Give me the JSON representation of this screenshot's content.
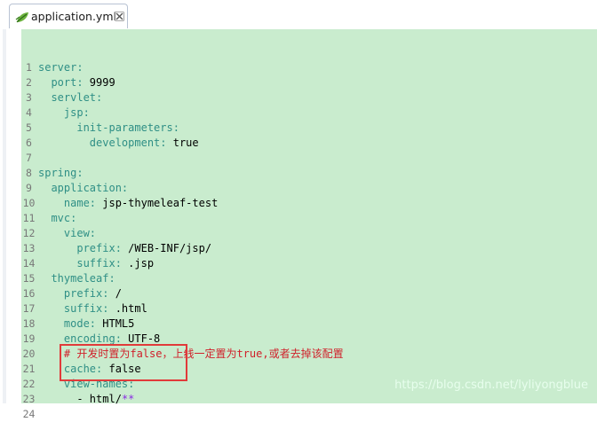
{
  "tab": {
    "title": "application.yml",
    "icon": "yaml-leaf-icon",
    "close_icon": "close-icon"
  },
  "editor": {
    "lines": [
      {
        "no": "1",
        "indent": "",
        "key": "server:",
        "value": "",
        "comment": ""
      },
      {
        "no": "2",
        "indent": "  ",
        "key": "port:",
        "value": " 9999",
        "comment": ""
      },
      {
        "no": "3",
        "indent": "  ",
        "key": "servlet:",
        "value": "",
        "comment": ""
      },
      {
        "no": "4",
        "indent": "    ",
        "key": "jsp:",
        "value": "",
        "comment": ""
      },
      {
        "no": "5",
        "indent": "      ",
        "key": "init-parameters:",
        "value": "",
        "comment": ""
      },
      {
        "no": "6",
        "indent": "        ",
        "key": "development:",
        "value": " true",
        "comment": ""
      },
      {
        "no": "7",
        "indent": "",
        "key": "",
        "value": "",
        "comment": ""
      },
      {
        "no": "8",
        "indent": "",
        "key": "spring:",
        "value": "",
        "comment": ""
      },
      {
        "no": "9",
        "indent": "  ",
        "key": "application:",
        "value": "",
        "comment": ""
      },
      {
        "no": "10",
        "indent": "    ",
        "key": "name:",
        "value": " jsp-thymeleaf-test",
        "comment": ""
      },
      {
        "no": "11",
        "indent": "  ",
        "key": "mvc:",
        "value": "",
        "comment": ""
      },
      {
        "no": "12",
        "indent": "    ",
        "key": "view:",
        "value": "",
        "comment": ""
      },
      {
        "no": "13",
        "indent": "      ",
        "key": "prefix:",
        "value": " /WEB-INF/jsp/",
        "comment": ""
      },
      {
        "no": "14",
        "indent": "      ",
        "key": "suffix:",
        "value": " .jsp",
        "comment": ""
      },
      {
        "no": "15",
        "indent": "  ",
        "key": "thymeleaf:",
        "value": "",
        "comment": ""
      },
      {
        "no": "16",
        "indent": "    ",
        "key": "prefix:",
        "value": " /",
        "comment": ""
      },
      {
        "no": "17",
        "indent": "    ",
        "key": "suffix:",
        "value": " .html",
        "comment": ""
      },
      {
        "no": "18",
        "indent": "    ",
        "key": "mode:",
        "value": " HTML5",
        "comment": ""
      },
      {
        "no": "19",
        "indent": "    ",
        "key": "encoding:",
        "value": " UTF-8",
        "comment": ""
      },
      {
        "no": "20",
        "indent": "    ",
        "key": "",
        "value": "",
        "comment": "# 开发时置为false，上线一定置为true,或者去掉该配置"
      },
      {
        "no": "21",
        "indent": "    ",
        "key": "cache:",
        "value": " false",
        "comment": ""
      },
      {
        "no": "22",
        "indent": "    ",
        "key": "view-names:",
        "value": "",
        "comment": ""
      },
      {
        "no": "23",
        "indent": "      ",
        "key": "",
        "value": "- html/",
        "glob": "**",
        "comment": ""
      },
      {
        "no": "24",
        "indent": "",
        "key": "",
        "value": "",
        "comment": ""
      }
    ]
  },
  "watermark": "https://blog.csdn.net/lyliyongblue",
  "colors": {
    "editor_bg": "#c9ecce",
    "key": "#2f8f86",
    "comment": "#d0202a",
    "highlight_border": "#e13a3a",
    "glob": "#8a2be2"
  }
}
